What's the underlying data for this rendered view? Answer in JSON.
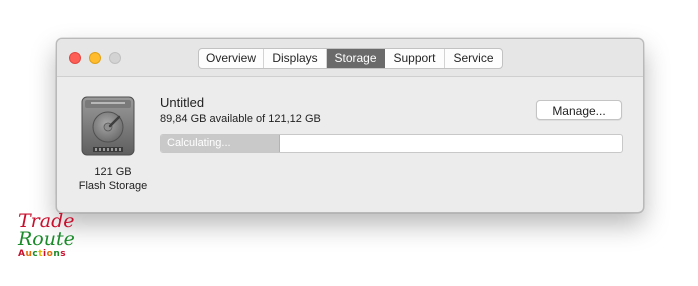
{
  "window": {
    "tabs": [
      {
        "label": "Overview",
        "active": false
      },
      {
        "label": "Displays",
        "active": false
      },
      {
        "label": "Storage",
        "active": true
      },
      {
        "label": "Support",
        "active": false
      },
      {
        "label": "Service",
        "active": false
      }
    ]
  },
  "disk": {
    "size_label": "121 GB",
    "type_label": "Flash Storage",
    "icon": "internal-drive-icon"
  },
  "volume": {
    "name": "Untitled",
    "availability": "89,84 GB available of 121,12 GB",
    "manage_label": "Manage...",
    "progress_label": "Calculating..."
  },
  "watermark": {
    "line1": "Trade",
    "line2": "Route",
    "line3": "Auctions"
  },
  "colors": {
    "close": "#fd5f57",
    "minimize": "#febc2e",
    "zoom_disabled": "#d3d3d3",
    "active_tab": "#6a6a6a"
  }
}
